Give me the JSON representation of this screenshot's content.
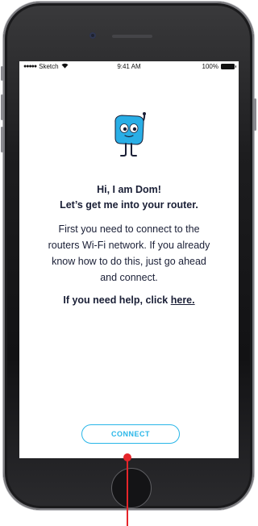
{
  "status_bar": {
    "carrier": "Sketch",
    "signal_dots": "●●●●●",
    "time": "9:41 AM",
    "battery": "100%"
  },
  "mascot": {
    "icon": "robot-mascot-icon",
    "colors": {
      "body": "#29aee6",
      "face": "#ffffff",
      "outline": "#1a1f36"
    }
  },
  "content": {
    "greeting_line1": "Hi, I am Dom!",
    "greeting_line2": "Let’s get me into your router.",
    "body_line1": "First you need to connect to the",
    "body_line2": "routers Wi-Fi network. If you already",
    "body_line3": "know how to do this, just go ahead",
    "body_line4": "and connect.",
    "help_prefix": "If you need help, click ",
    "help_link": "here."
  },
  "actions": {
    "connect_label": "CONNECT"
  },
  "colors": {
    "accent": "#28b6e8",
    "text": "#1a1f36",
    "annotation": "#e5252a"
  }
}
